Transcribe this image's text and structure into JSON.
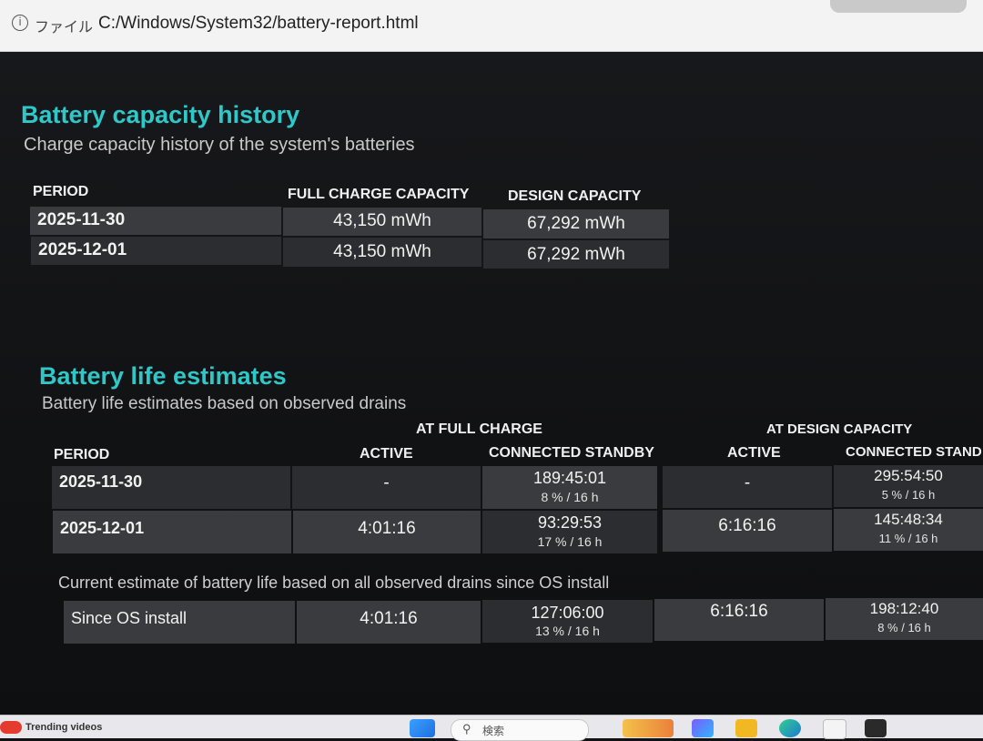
{
  "browser": {
    "file_label": "ファイル",
    "url": "C:/Windows/System32/battery-report.html"
  },
  "capacity": {
    "title": "Battery capacity history",
    "subtitle": "Charge capacity history of the system's batteries",
    "headers": {
      "period": "PERIOD",
      "full": "FULL CHARGE CAPACITY",
      "design": "DESIGN CAPACITY"
    },
    "rows": [
      {
        "period": "2025-11-30",
        "full": "43,150 mWh",
        "design": "67,292 mWh"
      },
      {
        "period": "2025-12-01",
        "full": "43,150 mWh",
        "design": "67,292 mWh"
      }
    ]
  },
  "life": {
    "title": "Battery life estimates",
    "subtitle": "Battery life estimates based on observed drains",
    "group_full": "AT FULL CHARGE",
    "group_design": "AT DESIGN CAPACITY",
    "headers": {
      "period": "PERIOD",
      "active": "ACTIVE",
      "standby": "CONNECTED STANDBY",
      "active2": "ACTIVE",
      "standby2": "CONNECTED STAND"
    },
    "rows": [
      {
        "period": "2025-11-30",
        "active": "-",
        "standby": "189:45:01",
        "standby_pct": "8 % / 16 h",
        "active2": "-",
        "standby2": "295:54:50",
        "standby2_pct": "5 % / 16 h"
      },
      {
        "period": "2025-12-01",
        "active": "4:01:16",
        "standby": "93:29:53",
        "standby_pct": "17 % / 16 h",
        "active2": "6:16:16",
        "standby2": "145:48:34",
        "standby2_pct": "11 % / 16 h"
      }
    ],
    "current_note": "Current estimate of battery life based on all observed drains since OS install",
    "since": {
      "period": "Since OS install",
      "active": "4:01:16",
      "standby": "127:06:00",
      "standby_pct": "13 % / 16 h",
      "active2": "6:16:16",
      "standby2": "198:12:40",
      "standby2_pct": "8 % / 16 h"
    }
  },
  "taskbar": {
    "trending": "Trending videos",
    "search_placeholder": "検索"
  }
}
